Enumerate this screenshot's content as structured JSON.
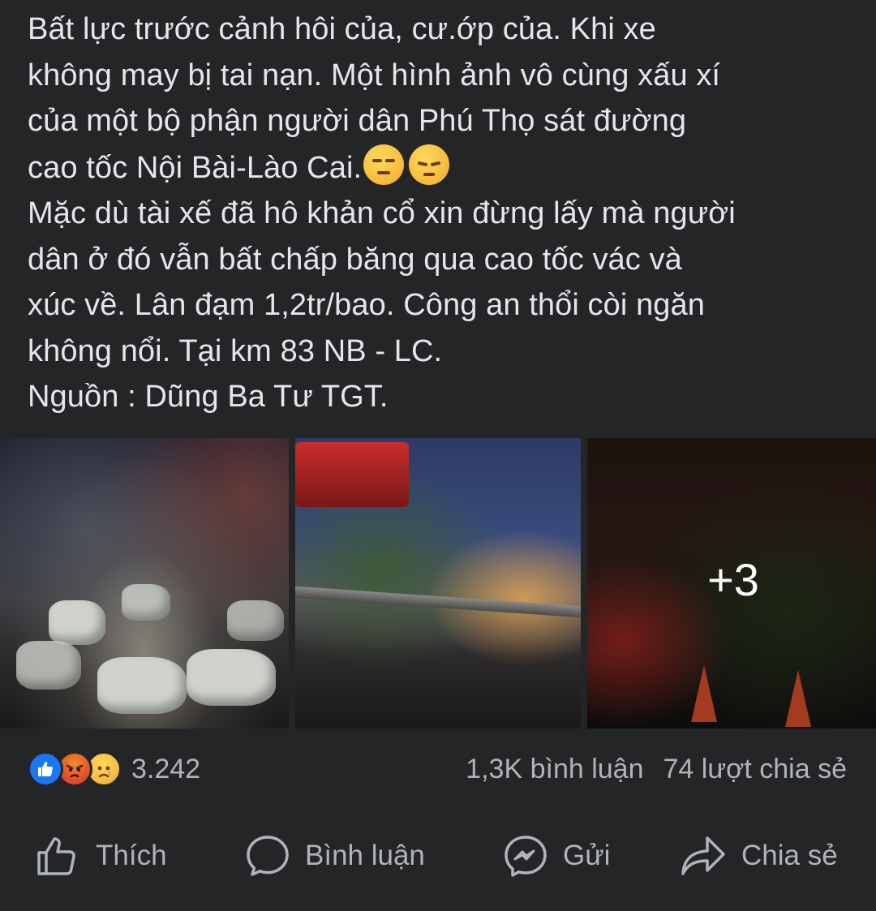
{
  "post": {
    "text_lines": [
      "Bất lực trước cảnh hôi của, cư.ớp của. Khi xe",
      "không may bị tai nạn. Một hình ảnh vô cùng xấu xí",
      "của một bộ phận người dân Phú Thọ sát đường",
      "cao tốc Nội Bài-Lào Cai.",
      "Mặc dù tài xế đã hô khản cổ xin đừng lấy mà người",
      "dân ở đó vẫn bất chấp băng qua cao tốc vác và",
      "xúc về. Lân đạm 1,2tr/bao. Công an thổi còi ngăn",
      "không nổi.  Tại km 83 NB - LC.",
      "Nguồn : Dũng Ba Tư TGT."
    ],
    "emojis": [
      "unamused-face",
      "pensive-face"
    ]
  },
  "photos": {
    "more_count": "+3"
  },
  "stats": {
    "reaction_icons": [
      "like",
      "angry",
      "sad"
    ],
    "reaction_count": "3.242",
    "comments": "1,3K bình luận",
    "shares": "74 lượt chia sẻ"
  },
  "actions": {
    "like_label": "Thích",
    "comment_label": "Bình luận",
    "send_label": "Gửi",
    "share_label": "Chia sẻ"
  },
  "colors": {
    "background": "#242526",
    "text_primary": "#e4e6eb",
    "text_secondary": "#b0b3b8",
    "like_blue": "#1877f2"
  }
}
